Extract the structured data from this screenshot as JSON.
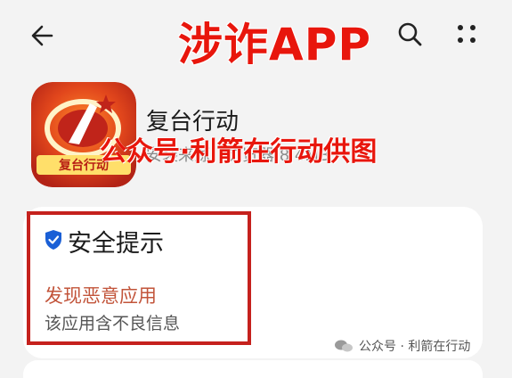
{
  "overlay": {
    "title": "涉诈APP",
    "watermark": "公众号·利箭在行动供图"
  },
  "app": {
    "name": "复台行动",
    "meta": "安装来源：浏览器 8.4MB",
    "logo_text": "复台行动"
  },
  "security": {
    "title": "安全提示",
    "warning": "发现恶意应用",
    "description": "该应用含不良信息"
  },
  "footer": {
    "source": "公众号 · 利箭在行动"
  },
  "icons": {
    "back": "back-arrow-icon",
    "search": "search-icon",
    "more": "more-vertical-icon",
    "shield": "shield-check-icon"
  },
  "colors": {
    "accent_red": "#e8160c",
    "box_red": "#c5211d",
    "warning_text": "#c2543a",
    "shield_blue": "#1a5fd6"
  }
}
